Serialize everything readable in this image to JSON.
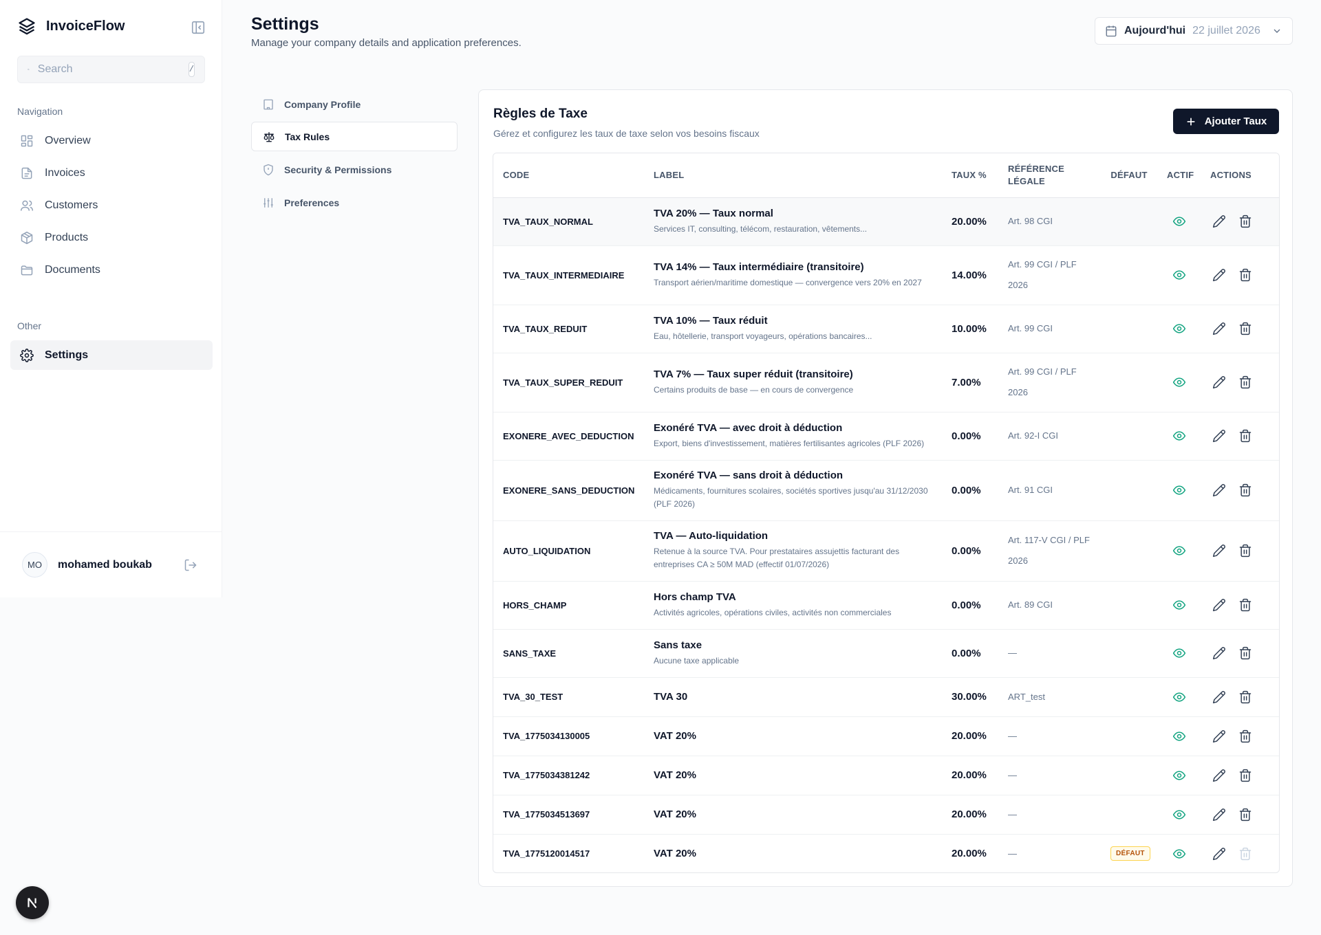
{
  "app": {
    "name": "InvoiceFlow"
  },
  "search": {
    "placeholder": "Search",
    "shortcut": "/"
  },
  "sidebar": {
    "nav_label": "Navigation",
    "items": [
      {
        "label": "Overview",
        "icon": "layout-grid-icon"
      },
      {
        "label": "Invoices",
        "icon": "file-text-icon"
      },
      {
        "label": "Customers",
        "icon": "users-icon"
      },
      {
        "label": "Products",
        "icon": "package-icon"
      },
      {
        "label": "Documents",
        "icon": "folder-icon"
      }
    ],
    "other_label": "Other",
    "other_items": [
      {
        "label": "Settings",
        "icon": "gear-icon",
        "active": true
      }
    ]
  },
  "user": {
    "initials": "MO",
    "name": "mohamed boukab"
  },
  "header": {
    "title": "Settings",
    "subtitle": "Manage your company details and application preferences.",
    "date_label": "Aujourd'hui",
    "date_value": "22 juillet 2026"
  },
  "settings_nav": [
    {
      "label": "Company Profile",
      "icon": "building-icon"
    },
    {
      "label": "Tax Rules",
      "icon": "scale-icon",
      "active": true
    },
    {
      "label": "Security & Permissions",
      "icon": "shield-icon"
    },
    {
      "label": "Preferences",
      "icon": "sliders-icon"
    }
  ],
  "card": {
    "title": "Règles de Taxe",
    "subtitle": "Gérez et configurez les taux de taxe selon vos besoins fiscaux",
    "add_button": "Ajouter Taux"
  },
  "table": {
    "columns": {
      "code": "CODE",
      "label": "LABEL",
      "rate": "TAUX %",
      "ref": "RÉFÉRENCE LÉGALE",
      "default": "DÉFAUT",
      "active": "ACTIF",
      "actions": "ACTIONS"
    },
    "default_badge": "DÉFAUT",
    "rows": [
      {
        "code": "TVA_TAUX_NORMAL",
        "label": "TVA 20% — Taux normal",
        "desc": "Services IT, consulting, télécom, restauration, vêtements...",
        "rate": "20.00%",
        "ref": "Art. 98 CGI",
        "is_default": false
      },
      {
        "code": "TVA_TAUX_INTERMEDIAIRE",
        "label": "TVA 14% — Taux intermédiaire (transitoire)",
        "desc": "Transport aérien/maritime domestique — convergence vers 20% en 2027",
        "rate": "14.00%",
        "ref": "Art. 99 CGI / PLF 2026",
        "is_default": false
      },
      {
        "code": "TVA_TAUX_REDUIT",
        "label": "TVA 10% — Taux réduit",
        "desc": "Eau, hôtellerie, transport voyageurs, opérations bancaires...",
        "rate": "10.00%",
        "ref": "Art. 99 CGI",
        "is_default": false
      },
      {
        "code": "TVA_TAUX_SUPER_REDUIT",
        "label": "TVA 7% — Taux super réduit (transitoire)",
        "desc": "Certains produits de base — en cours de convergence",
        "rate": "7.00%",
        "ref": "Art. 99 CGI / PLF 2026",
        "is_default": false
      },
      {
        "code": "EXONERE_AVEC_DEDUCTION",
        "label": "Exonéré TVA — avec droit à déduction",
        "desc": "Export, biens d'investissement, matières fertilisantes agricoles (PLF 2026)",
        "rate": "0.00%",
        "ref": "Art. 92-I CGI",
        "is_default": false
      },
      {
        "code": "EXONERE_SANS_DEDUCTION",
        "label": "Exonéré TVA — sans droit à déduction",
        "desc": "Médicaments, fournitures scolaires, sociétés sportives jusqu'au 31/12/2030 (PLF 2026)",
        "rate": "0.00%",
        "ref": "Art. 91 CGI",
        "is_default": false
      },
      {
        "code": "AUTO_LIQUIDATION",
        "label": "TVA — Auto-liquidation",
        "desc": "Retenue à la source TVA. Pour prestataires assujettis facturant des entreprises CA ≥ 50M MAD (effectif 01/07/2026)",
        "rate": "0.00%",
        "ref": "Art. 117-V CGI / PLF 2026",
        "is_default": false
      },
      {
        "code": "HORS_CHAMP",
        "label": "Hors champ TVA",
        "desc": "Activités agricoles, opérations civiles, activités non commerciales",
        "rate": "0.00%",
        "ref": "Art. 89 CGI",
        "is_default": false
      },
      {
        "code": "SANS_TAXE",
        "label": "Sans taxe",
        "desc": "Aucune taxe applicable",
        "rate": "0.00%",
        "ref": "—",
        "is_default": false
      },
      {
        "code": "TVA_30_TEST",
        "label": "TVA 30",
        "desc": "",
        "rate": "30.00%",
        "ref": "ART_test",
        "is_default": false
      },
      {
        "code": "TVA_1775034130005",
        "label": "VAT 20%",
        "desc": "",
        "rate": "20.00%",
        "ref": "—",
        "is_default": false
      },
      {
        "code": "TVA_1775034381242",
        "label": "VAT 20%",
        "desc": "",
        "rate": "20.00%",
        "ref": "—",
        "is_default": false
      },
      {
        "code": "TVA_1775034513697",
        "label": "VAT 20%",
        "desc": "",
        "rate": "20.00%",
        "ref": "—",
        "is_default": false
      },
      {
        "code": "TVA_1775120014517",
        "label": "VAT 20%",
        "desc": "",
        "rate": "20.00%",
        "ref": "—",
        "is_default": true
      }
    ]
  },
  "colors": {
    "primary": "#0f172a",
    "active_eye": "#10a37f",
    "badge_text": "#b45309",
    "badge_bg": "#fffbeb"
  }
}
